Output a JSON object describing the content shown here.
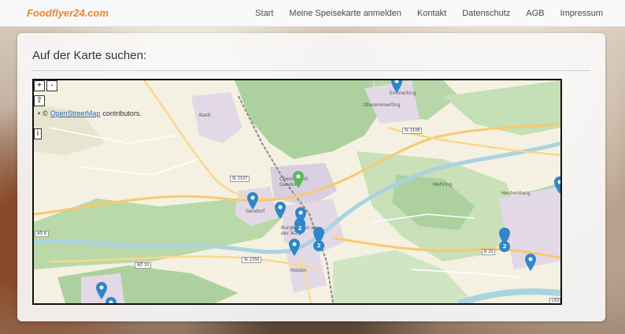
{
  "navbar": {
    "brand": "Foodflyer24.com",
    "links": [
      "Start",
      "Meine Speisekarte anmelden",
      "Kontakt",
      "Datenschutz",
      "AGB",
      "Impressum"
    ]
  },
  "card": {
    "title": "Auf der Karte suchen:"
  },
  "map": {
    "controls": {
      "zoom_in": "+",
      "zoom_out": "-",
      "up": "⇧",
      "info": "i"
    },
    "attribution": {
      "bullet": "•",
      "copyright": "©",
      "link": "OpenStreetMap",
      "suffix": "contributors."
    },
    "place_labels": [
      "Kastl",
      "Emmerting",
      "Oberemmerting",
      "Gendorf",
      "Mehring",
      "Burgkirchen an der Alz",
      "Holzen",
      "Hechenberg",
      "Chemiepark Gendorf"
    ],
    "road_labels": [
      "St 2108",
      "St 2107",
      "AÖ 6",
      "AÖ 10",
      "St 2356",
      "B 20",
      "L501"
    ],
    "markers": [
      {
        "kind": "single",
        "color": "#2f86c8"
      },
      {
        "kind": "single",
        "color": "#2f86c8"
      },
      {
        "kind": "single",
        "color": "#2f86c8"
      },
      {
        "kind": "single",
        "color": "#2f86c8"
      },
      {
        "kind": "cluster",
        "label": "2",
        "color": "#2f86c8"
      },
      {
        "kind": "cluster",
        "label": "2",
        "color": "#2f86c8"
      },
      {
        "kind": "single",
        "color": "#2f86c8"
      },
      {
        "kind": "cluster",
        "label": "2",
        "color": "#2f86c8"
      },
      {
        "kind": "single",
        "color": "#2f86c8"
      },
      {
        "kind": "single",
        "color": "#2f86c8"
      },
      {
        "kind": "single",
        "color": "#2f86c8"
      },
      {
        "kind": "single",
        "color": "#2f86c8"
      },
      {
        "kind": "highlight",
        "color": "#5cb85c"
      }
    ]
  },
  "colors": {
    "brand": "#e8862a",
    "marker_blue": "#2f86c8",
    "marker_green": "#5cb85c",
    "forest": "#add19e",
    "urban": "#e3d9e6"
  }
}
